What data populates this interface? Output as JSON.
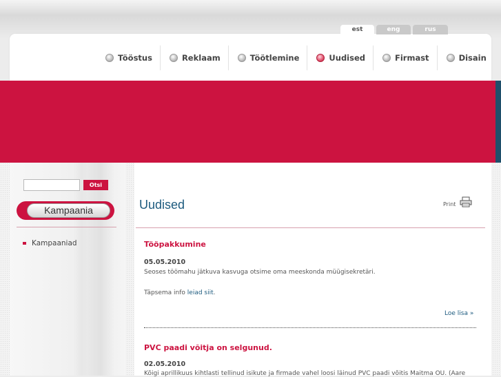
{
  "languages": [
    {
      "label": "est",
      "active": true
    },
    {
      "label": "eng",
      "active": false
    },
    {
      "label": "rus",
      "active": false
    }
  ],
  "nav": [
    {
      "label": "Tööstus",
      "active": false
    },
    {
      "label": "Reklaam",
      "active": false
    },
    {
      "label": "Töötlemine",
      "active": false
    },
    {
      "label": "Uudised",
      "active": true
    },
    {
      "label": "Firmast",
      "active": false
    },
    {
      "label": "Disain",
      "active": false
    }
  ],
  "search": {
    "value": "",
    "button_label": "Otsi"
  },
  "sidebar": {
    "heading": "Kampaania",
    "items": [
      {
        "label": "Kampaaniad"
      }
    ]
  },
  "page": {
    "title": "Uudised",
    "print_label": "Print"
  },
  "news": [
    {
      "title": "Tööpakkumine",
      "date": "05.05.2010",
      "text": "Seoses töömahu jätkuva kasvuga otsime oma meeskonda müügisekretäri.",
      "more_prefix": "Täpsema info ",
      "more_link": "leiad siit",
      "more_suffix": ".",
      "read_more": "Loe lisa »"
    },
    {
      "title": "PVC paadi võitja on selgunud.",
      "date": "02.05.2010",
      "text": "Kõigi aprillikuus kihtlasti tellinud isikute ja firmade vahel loosi läinud PVC paadi võitis Maitma OÜ. (Aare"
    }
  ],
  "colors": {
    "brand_red": "#cc1340",
    "link_blue": "#1c5a7e"
  }
}
